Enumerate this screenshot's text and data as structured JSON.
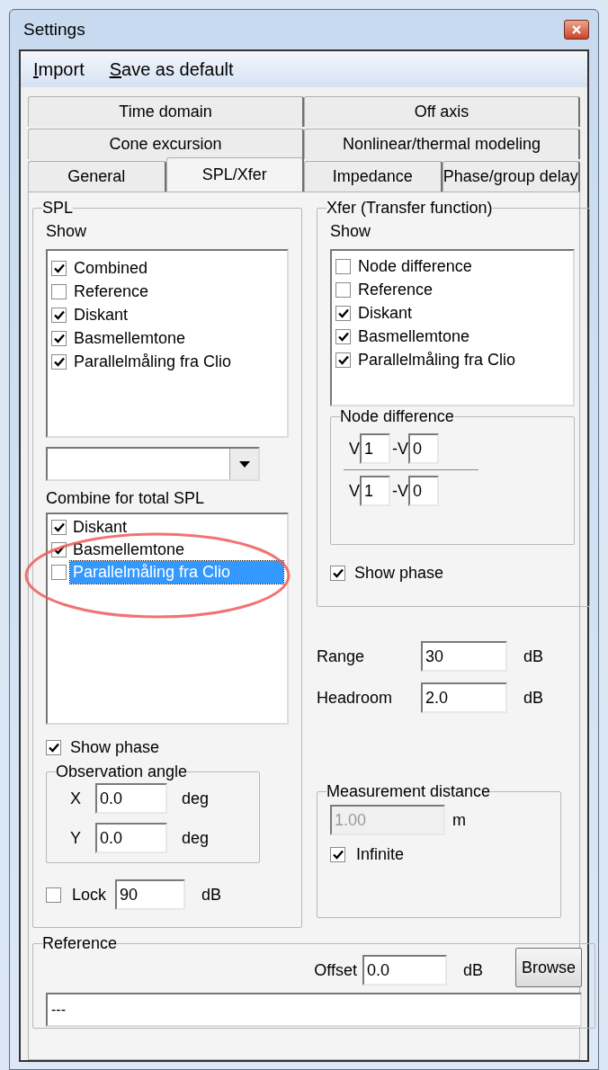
{
  "window": {
    "title": "Settings"
  },
  "menu": [
    {
      "label": "Import"
    },
    {
      "label": "Save as default"
    }
  ],
  "tab_rows": [
    {
      "tabs": [
        {
          "label": "Time domain",
          "selected": false
        },
        {
          "label": "Off axis",
          "selected": false
        }
      ]
    },
    {
      "tabs": [
        {
          "label": "Cone excursion",
          "selected": false
        },
        {
          "label": "Nonlinear/thermal modeling",
          "selected": false
        }
      ]
    },
    {
      "tabs": [
        {
          "label": "General",
          "selected": false
        },
        {
          "label": "SPL/Xfer",
          "selected": true
        },
        {
          "label": "Impedance",
          "selected": false
        },
        {
          "label": "Phase/group delay",
          "selected": false
        }
      ]
    }
  ],
  "spl": {
    "title": "SPL",
    "show_label": "Show",
    "show_items": [
      {
        "label": "Combined",
        "checked": true
      },
      {
        "label": "Reference",
        "checked": false
      },
      {
        "label": "Diskant",
        "checked": true
      },
      {
        "label": "Basmellemtone",
        "checked": true
      },
      {
        "label": "Parallelmåling fra Clio",
        "checked": true
      }
    ],
    "combine_label": "Combine for total SPL",
    "combine_items": [
      {
        "label": "Diskant",
        "checked": true,
        "selected": false
      },
      {
        "label": "Basmellemtone",
        "checked": true,
        "selected": false
      },
      {
        "label": "Parallelmåling fra Clio",
        "checked": false,
        "selected": true
      }
    ],
    "show_phase": {
      "label": "Show phase",
      "checked": true
    },
    "observation_angle": {
      "title": "Observation angle",
      "fields": [
        {
          "label": "X",
          "value": "0.0",
          "unit": "deg"
        },
        {
          "label": "Y",
          "value": "0.0",
          "unit": "deg"
        }
      ]
    },
    "lock": {
      "label": "Lock",
      "checked": false,
      "value": "90",
      "unit": "dB"
    }
  },
  "xfer": {
    "title": "Xfer (Transfer function)",
    "show_label": "Show",
    "show_items": [
      {
        "label": "Node difference",
        "checked": false
      },
      {
        "label": "Reference",
        "checked": false
      },
      {
        "label": "Diskant",
        "checked": true
      },
      {
        "label": "Basmellemtone",
        "checked": true
      },
      {
        "label": "Parallelmåling fra Clio",
        "checked": true
      }
    ],
    "node_difference": {
      "title": "Node difference",
      "rows": [
        {
          "label_1": "V",
          "value_1": "1",
          "label_2": "-V",
          "value_2": "0"
        },
        {
          "label_1": "V",
          "value_1": "1",
          "label_2": "-V",
          "value_2": "0"
        }
      ]
    },
    "show_phase": {
      "label": "Show phase",
      "checked": true
    }
  },
  "range": {
    "label": "Range",
    "value": "30",
    "unit": "dB"
  },
  "headroom": {
    "label": "Headroom",
    "value": "2.0",
    "unit": "dB"
  },
  "measurement_distance": {
    "title": "Measurement distance",
    "value": "1.00",
    "disabled": true,
    "unit": "m",
    "infinite": {
      "label": "Infinite",
      "checked": true
    }
  },
  "reference": {
    "title": "Reference",
    "offset": {
      "label": "Offset",
      "value": "0.0",
      "unit": "dB"
    },
    "browse_button": "Browse",
    "path": "---"
  }
}
